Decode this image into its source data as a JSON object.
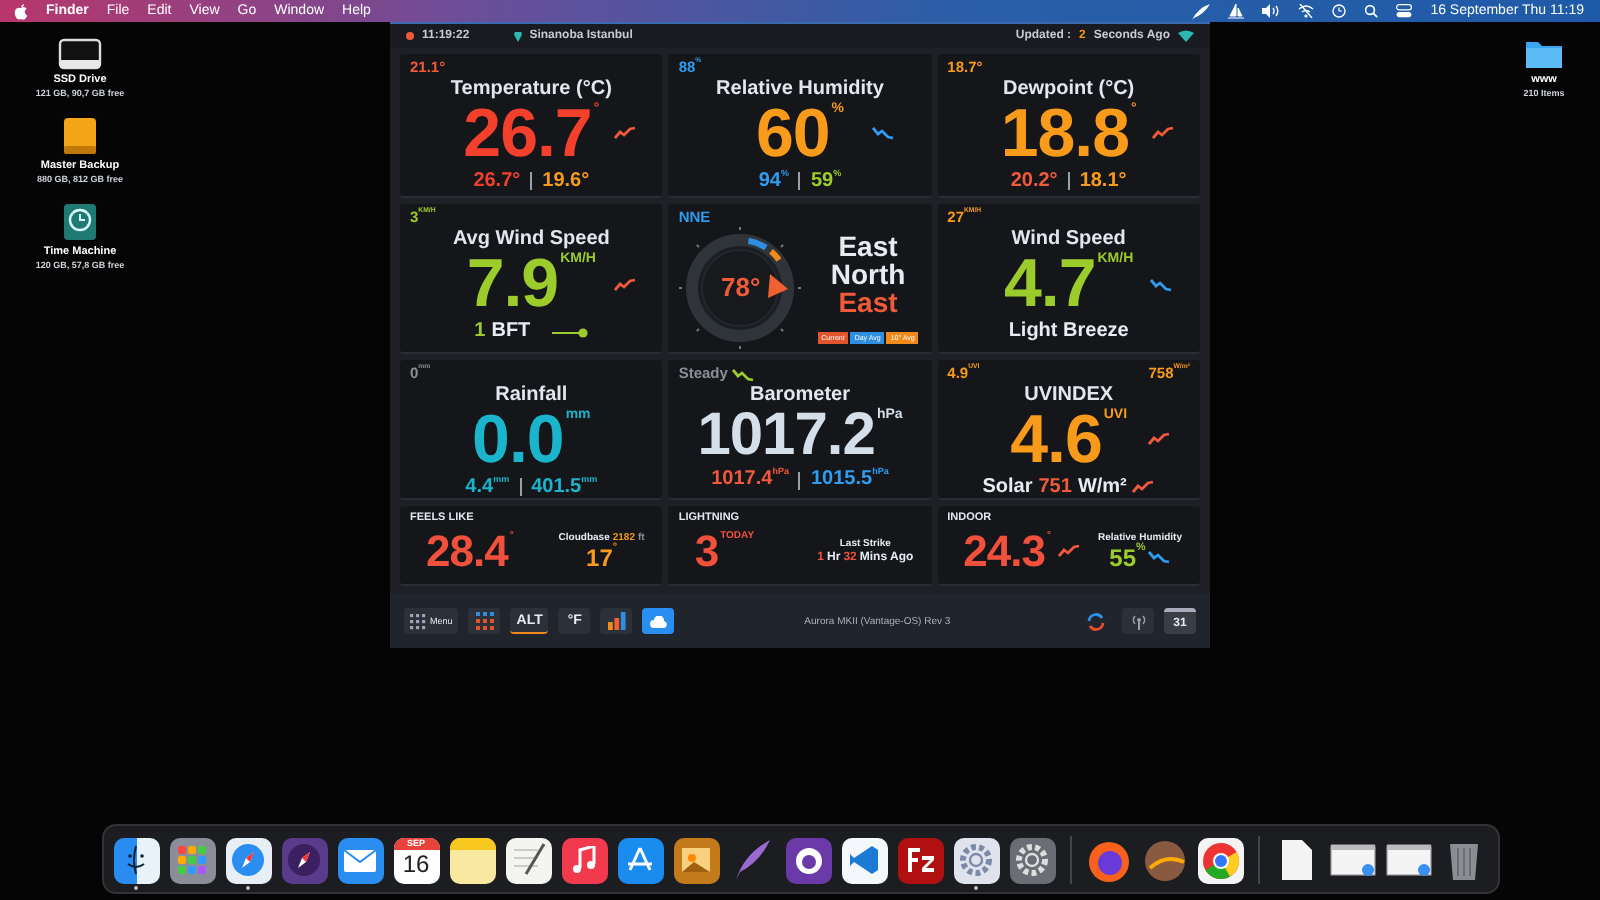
{
  "menu_bar": {
    "app_name": "Finder",
    "menus": [
      "File",
      "Edit",
      "View",
      "Go",
      "Window",
      "Help"
    ],
    "clock": "16 September Thu  11:19"
  },
  "desktop": {
    "left_icons": [
      {
        "kind": "drive",
        "name": "SSD Drive",
        "detail": "121 GB, 90,7 GB free"
      },
      {
        "kind": "backup",
        "name": "Master Backup",
        "detail": "880 GB, 812 GB free"
      },
      {
        "kind": "time_machine",
        "name": "Time Machine",
        "detail": "120 GB, 57,8 GB free"
      }
    ],
    "right_icons": [
      {
        "kind": "folder",
        "name": "www",
        "detail": "210 Items"
      }
    ]
  },
  "widget": {
    "header": {
      "time": "11:19:22",
      "location": "Sinanoba Istanbul",
      "updated": [
        {
          "text": "Updated :",
          "color": "#c8ccd2"
        },
        {
          "text": "2",
          "color": "#f89a1a"
        },
        {
          "text": "Seconds Ago",
          "color": "#c8ccd2"
        }
      ]
    },
    "cards": [
      {
        "kind": "metric",
        "corner": [
          {
            "text": "21.1°",
            "color": "#f05a3a"
          }
        ],
        "title": "Temperature (°C)",
        "value": {
          "text": "26.7",
          "unit": "°",
          "color": "#f2402c"
        },
        "trend": {
          "kind": "rising",
          "color": "#f05a3a"
        },
        "sub": {
          "separated": true,
          "items": [
            {
              "text": "26.7°",
              "color": "#f2402c"
            },
            {
              "text": "19.6°",
              "color": "#f89a1a"
            }
          ]
        }
      },
      {
        "kind": "metric",
        "corner": [
          {
            "text": "88",
            "unit": "%",
            "color": "#2f9cf0"
          }
        ],
        "title": "Relative Humidity",
        "value": {
          "text": "60",
          "unit": "%",
          "color": "#f89a1a"
        },
        "trend": {
          "kind": "falling",
          "color": "#2f9cf0"
        },
        "sub": {
          "separated": true,
          "items": [
            {
              "text": "94",
              "unit": "%",
              "color": "#2f9cf0"
            },
            {
              "text": "59",
              "unit": "%",
              "color": "#9ccc2c"
            }
          ]
        }
      },
      {
        "kind": "metric",
        "corner": [
          {
            "text": "18.7°",
            "color": "#f89a1a"
          }
        ],
        "title": "Dewpoint (°C)",
        "value": {
          "text": "18.8",
          "unit": "°",
          "color": "#f89a1a"
        },
        "trend": {
          "kind": "rising",
          "color": "#f05a3a"
        },
        "sub": {
          "separated": true,
          "items": [
            {
              "text": "20.2°",
              "color": "#f05a3a"
            },
            {
              "text": "18.1°",
              "color": "#f89a1a"
            }
          ]
        }
      },
      {
        "kind": "metric",
        "corner": [
          {
            "text": "3",
            "unit": "KM/H",
            "color": "#9ccc2c"
          }
        ],
        "title": "Avg Wind Speed",
        "value": {
          "text": "7.9",
          "unit": "KM/H",
          "color": "#9ccc2c"
        },
        "trend": {
          "kind": "rising",
          "color": "#f05a3a"
        },
        "sub": {
          "separated": false,
          "items": [
            {
              "text": "1",
              "color": "#9ccc2c"
            },
            {
              "text": "BFT",
              "color": "#e6ecf2"
            },
            {
              "kind": "gauge",
              "color": "#9ccc2c"
            }
          ]
        }
      },
      {
        "kind": "compass",
        "corner": [
          {
            "text": "NNE",
            "color": "#2f9cf0"
          }
        ],
        "degrees": "78°",
        "direction": [
          {
            "text": "East",
            "color": "#e6ecf2"
          },
          {
            "text": "North",
            "color": "#e6ecf2"
          },
          {
            "text": "East",
            "color": "#f05a3a"
          }
        ],
        "legend": [
          {
            "text": "Current",
            "color": "#e0552c"
          },
          {
            "text": "Day Avg",
            "color": "#2f8ee0"
          },
          {
            "text": "10° Avg",
            "color": "#f08a1a"
          }
        ]
      },
      {
        "kind": "metric",
        "corner": [
          {
            "text": "27",
            "unit": "KM/H",
            "color": "#f89a1a"
          }
        ],
        "title": "Wind Speed",
        "value": {
          "text": "4.7",
          "unit": "KM/H",
          "color": "#9ccc2c"
        },
        "trend": {
          "kind": "falling",
          "color": "#2f9cf0"
        },
        "sub": {
          "items": [
            {
              "text": "Light Breeze",
              "color": "#e6ecf2"
            }
          ]
        }
      },
      {
        "kind": "metric",
        "corner": [
          {
            "text": "0",
            "unit": "mm",
            "color": "#8a9098"
          }
        ],
        "title": "Rainfall",
        "value": {
          "text": "0.0",
          "unit": "mm",
          "color": "#1ab4cc"
        },
        "sub": {
          "separated": true,
          "items": [
            {
              "text": "4.4",
              "unit": "mm",
              "color": "#1ab4cc"
            },
            {
              "text": "401.5",
              "unit": "mm",
              "color": "#1ab4cc"
            }
          ]
        }
      },
      {
        "kind": "metric",
        "corner": [
          {
            "text": "Steady",
            "color": "#8a9098"
          },
          {
            "kind": "falling",
            "color": "#9ccc2c"
          }
        ],
        "title": "Barometer",
        "value": {
          "text": "1017.2",
          "unit": "hPa",
          "color": "#d4dfea"
        },
        "sub": {
          "separated": true,
          "items": [
            {
              "text": "1017.4",
              "unit": "hPa",
              "color": "#f05a3a"
            },
            {
              "text": "1015.5",
              "unit": "hPa",
              "color": "#2f9cf0"
            }
          ]
        }
      },
      {
        "kind": "metric",
        "corner": [
          {
            "text": "4.9",
            "unit": "UVI",
            "color": "#f89a1a"
          }
        ],
        "corner_right": [
          {
            "text": "758",
            "unit": "W/m²",
            "color": "#f89a1a"
          }
        ],
        "title": "UVINDEX",
        "value": {
          "text": "4.6",
          "unit": "UVI",
          "color": "#f89a1a"
        },
        "trend": {
          "kind": "rising",
          "color": "#f05a3a"
        },
        "sub": {
          "separated": false,
          "items": [
            {
              "text": "Solar",
              "color": "#e6ecf2"
            },
            {
              "text": "751",
              "color": "#f05a3a"
            },
            {
              "text": "W/m²",
              "color": "#e6ecf2"
            },
            {
              "kind": "rising",
              "color": "#f05a3a"
            }
          ]
        }
      },
      {
        "kind": "compact",
        "title": "FEELS LIKE",
        "value": {
          "text": "28.4",
          "unit": "°",
          "color": "#f0503c"
        },
        "side": {
          "kind": "big",
          "caption": [
            {
              "text": "Cloudbase",
              "color": "#e6ecf2"
            },
            {
              "text": "2182",
              "color": "#f89a1a"
            },
            {
              "text": "ft",
              "color": "#8a9098"
            }
          ],
          "detail": [
            {
              "text": "17",
              "unit": "°",
              "color": "#f89a1a"
            }
          ]
        }
      },
      {
        "kind": "compact",
        "title": "LIGHTNING",
        "value": {
          "text": "3",
          "unit": "TODAY",
          "color": "#f0503c"
        },
        "side": {
          "kind": "small",
          "caption": [
            {
              "text": "Last Strike",
              "color": "#e6ecf2"
            }
          ],
          "detail": [
            {
              "text": "1",
              "color": "#f0503c"
            },
            {
              "text": "Hr",
              "color": "#e6ecf2"
            },
            {
              "text": "32",
              "color": "#f0503c"
            },
            {
              "text": "Mins Ago",
              "color": "#e6ecf2"
            }
          ]
        }
      },
      {
        "kind": "compact",
        "title": "INDOOR",
        "value": {
          "text": "24.3",
          "unit": "°",
          "color": "#f0503c"
        },
        "trend": {
          "kind": "rising",
          "color": "#f05a3a"
        },
        "side": {
          "kind": "big",
          "caption": [
            {
              "text": "Relative Humidity",
              "color": "#e6ecf2"
            }
          ],
          "detail": [
            {
              "text": "55",
              "unit": "%",
              "color": "#9ccc2c"
            },
            {
              "kind": "falling",
              "color": "#2f9cf0"
            }
          ]
        }
      }
    ],
    "toolbar": {
      "left": [
        {
          "kind": "menu",
          "label": "Menu"
        },
        {
          "kind": "grid"
        },
        {
          "kind": "alt",
          "label": "ALT"
        },
        {
          "kind": "unit",
          "label": "°F"
        },
        {
          "kind": "chart"
        },
        {
          "kind": "cloud"
        }
      ],
      "center": "Aurora MKII (Vantage-OS) Rev 3",
      "right": [
        {
          "kind": "refresh"
        },
        {
          "kind": "antenna"
        },
        {
          "kind": "calendar",
          "label": "31"
        }
      ]
    }
  },
  "dock": {
    "items": [
      {
        "kind": "finder",
        "running": true
      },
      {
        "kind": "launchpad",
        "running": false
      },
      {
        "kind": "safari",
        "running": true
      },
      {
        "kind": "compass_purple",
        "running": false
      },
      {
        "kind": "mail",
        "running": false
      },
      {
        "kind": "calendar",
        "month": "SEP",
        "day": "16",
        "running": false
      },
      {
        "kind": "notes",
        "running": false
      },
      {
        "kind": "textedit",
        "running": false
      },
      {
        "kind": "music",
        "running": false
      },
      {
        "kind": "appstore",
        "running": false
      },
      {
        "kind": "preview",
        "running": false
      },
      {
        "kind": "quill",
        "running": false
      },
      {
        "kind": "github",
        "running": false
      },
      {
        "kind": "vscode",
        "running": false
      },
      {
        "kind": "filezilla",
        "running": false
      },
      {
        "kind": "gear",
        "running": true
      },
      {
        "kind": "settings",
        "running": false
      },
      {
        "kind": "separator"
      },
      {
        "kind": "firefox",
        "running": false
      },
      {
        "kind": "ball",
        "running": false
      },
      {
        "kind": "chrome",
        "running": false
      },
      {
        "kind": "separator"
      },
      {
        "kind": "document",
        "running": false
      },
      {
        "kind": "window",
        "running": false
      },
      {
        "kind": "window_small",
        "running": false
      },
      {
        "kind": "trash",
        "running": false
      }
    ]
  }
}
